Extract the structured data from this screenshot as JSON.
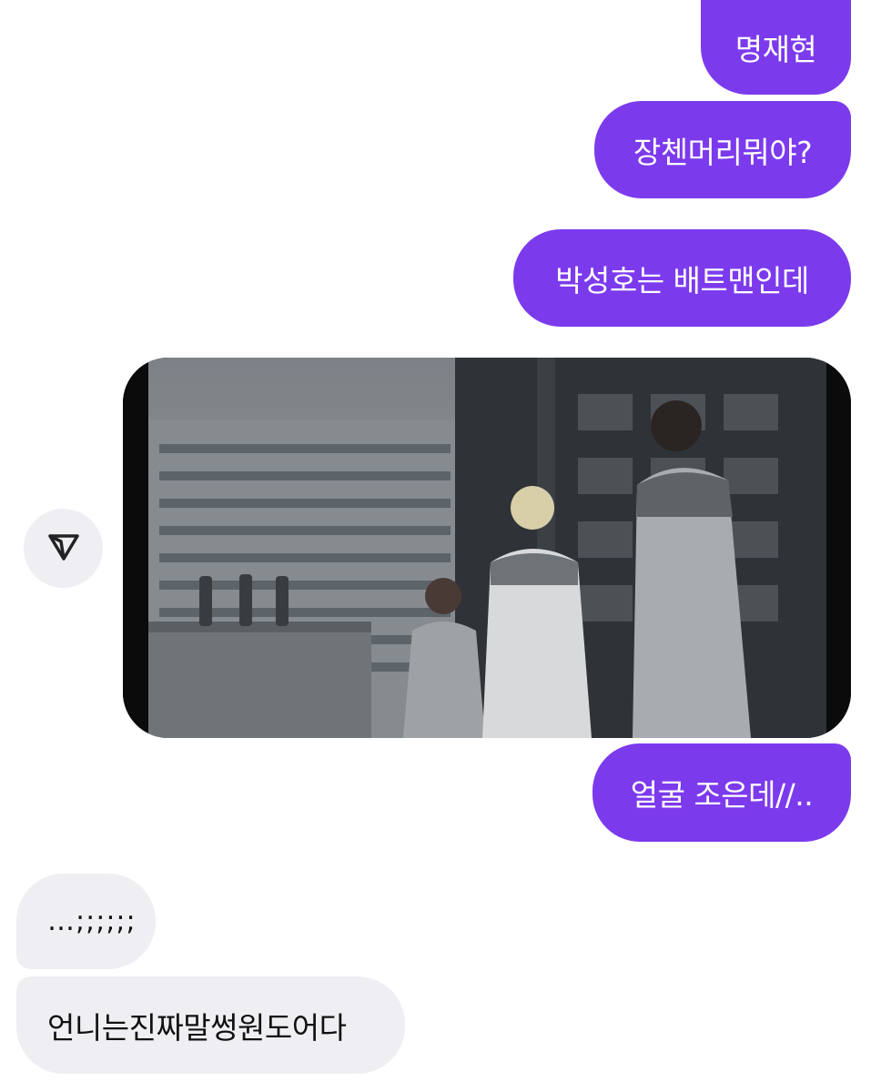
{
  "messages": {
    "sent_1": "명재현",
    "sent_2": "장첸머리뭐야?",
    "sent_3": "박성호는 배트맨인데",
    "sent_4": "얼굴 조은데//..",
    "received_1": "…;;;;;;",
    "received_2": "언니는진짜말썽원도어다"
  },
  "media": {
    "type": "image",
    "description_icon": "video-still"
  },
  "icons": {
    "share": "send-triangle-icon"
  },
  "colors": {
    "sent_bubble": "#7c3aed",
    "received_bubble": "#efeff3",
    "sent_text": "#ffffff",
    "received_text": "#111111"
  }
}
